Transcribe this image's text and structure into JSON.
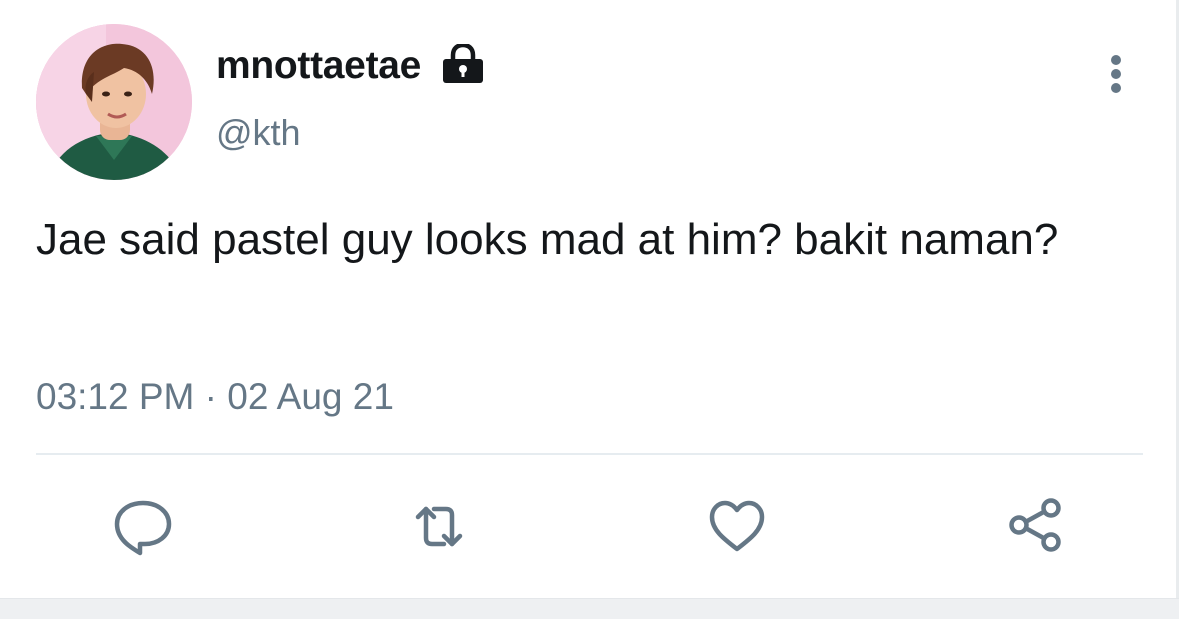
{
  "user": {
    "display_name": "mnottaetae",
    "handle": "@kth",
    "avatar_icon": "profile-photo",
    "protected_icon": "lock-icon"
  },
  "tweet": {
    "text": "Jae said pastel guy looks mad at him? bakit naman?",
    "timestamp": "03:12 PM · 02 Aug 21"
  },
  "actions": [
    {
      "name": "reply",
      "icon": "speech-bubble-icon"
    },
    {
      "name": "retweet",
      "icon": "retweet-icon"
    },
    {
      "name": "like",
      "icon": "heart-icon"
    },
    {
      "name": "share",
      "icon": "share-icon"
    }
  ],
  "menu": {
    "icon": "vertical-dots-icon"
  },
  "colors": {
    "text": "#14171a",
    "secondary_text": "#657786",
    "icon": "#657786",
    "divider": "#e6ecf0",
    "avatar_bg": "#f3c6dc"
  }
}
